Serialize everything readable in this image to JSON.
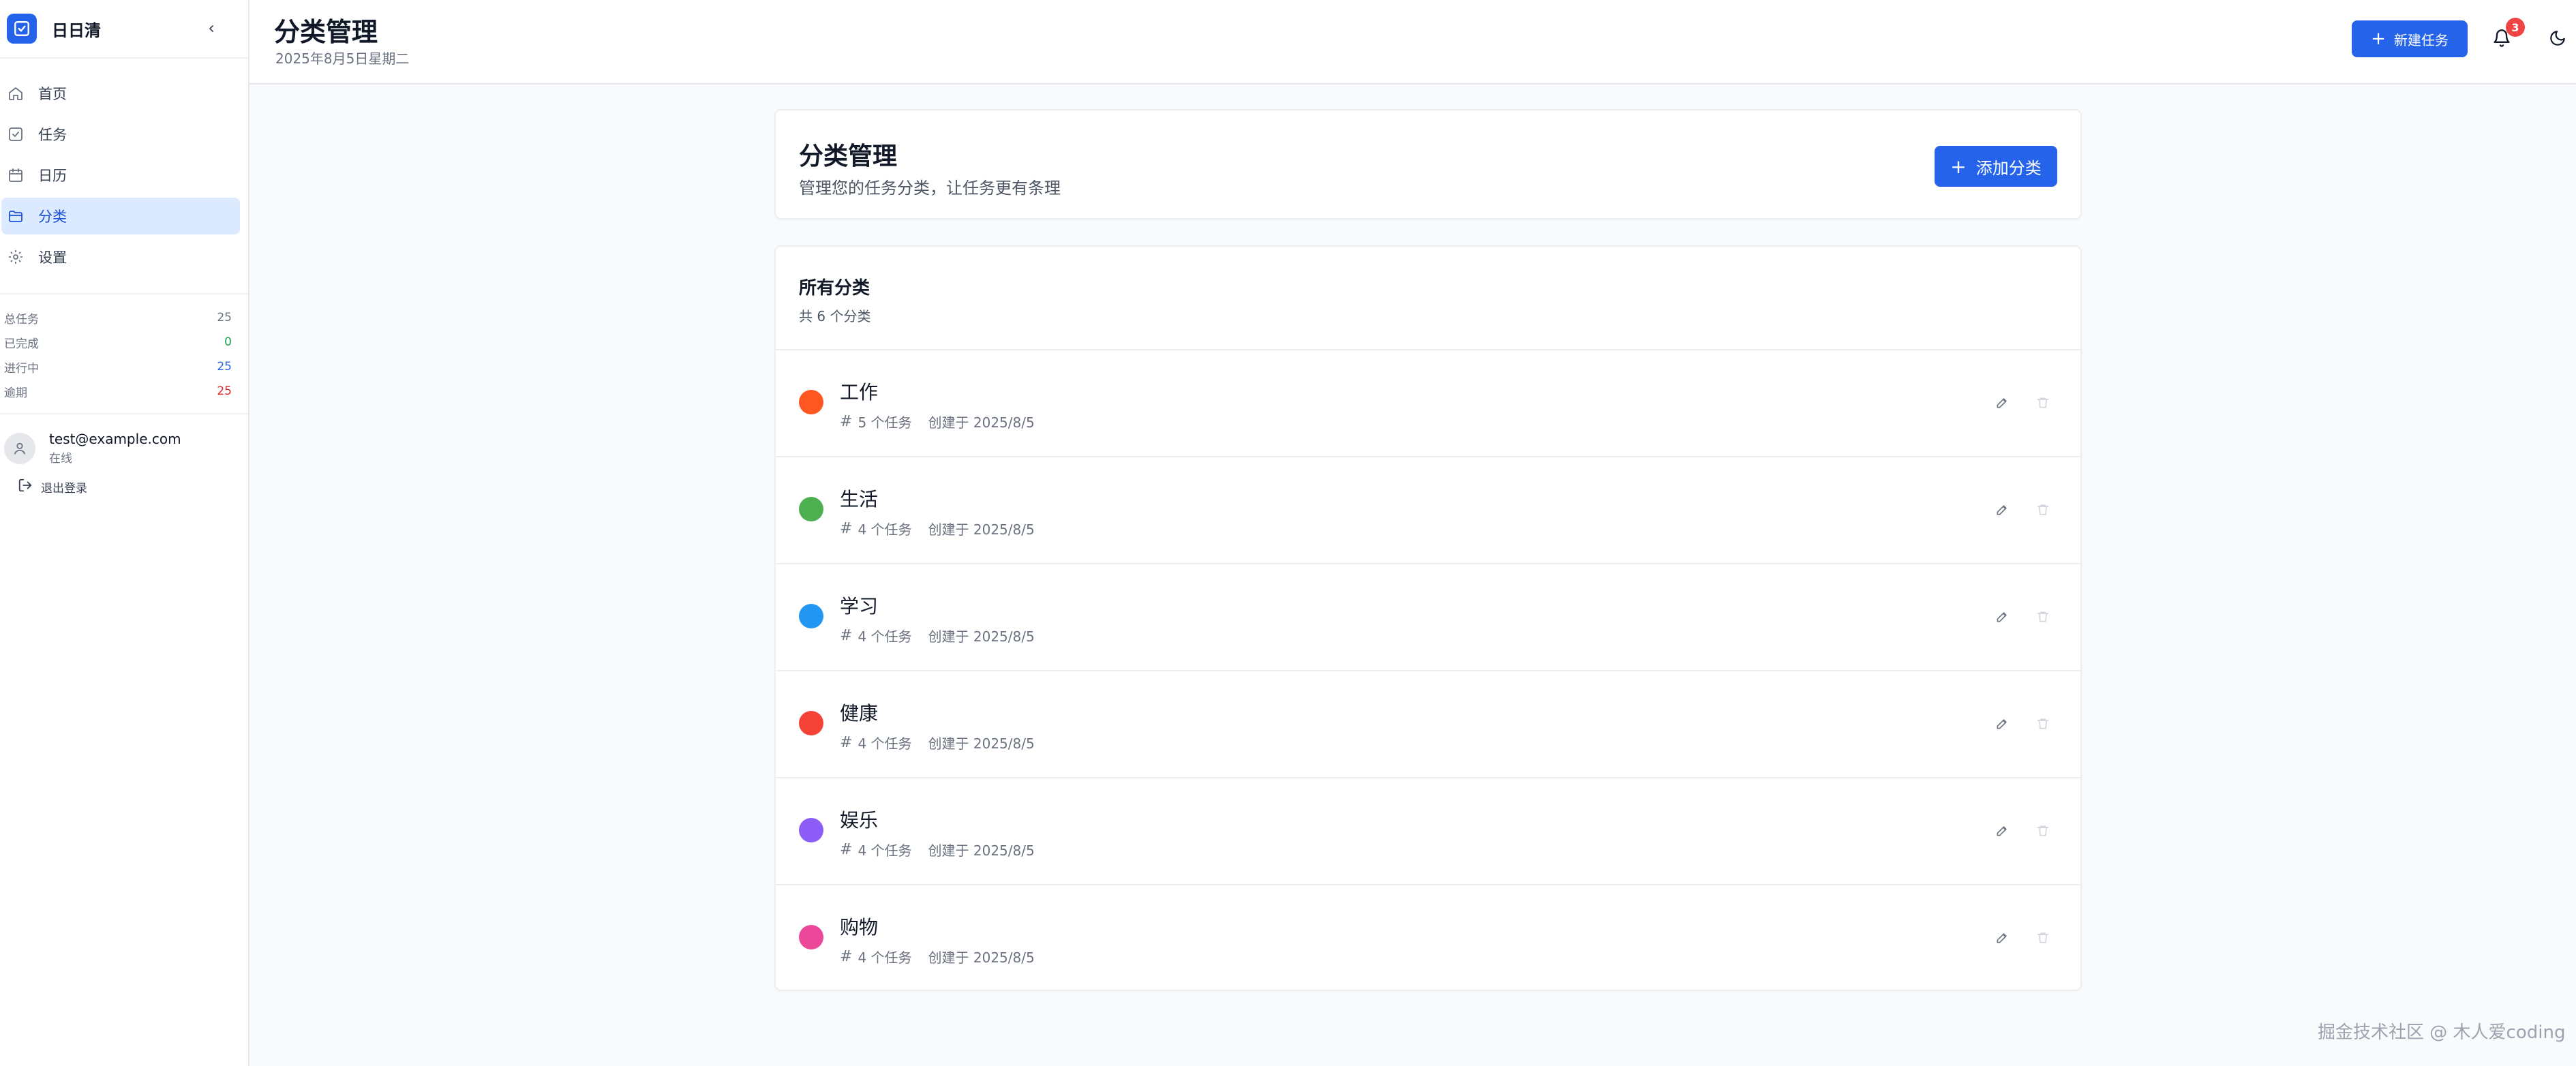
{
  "app": {
    "name": "日日清"
  },
  "sidebar": {
    "items": [
      {
        "label": "首页",
        "icon": "home-icon"
      },
      {
        "label": "任务",
        "icon": "task-check-icon"
      },
      {
        "label": "日历",
        "icon": "calendar-icon"
      },
      {
        "label": "分类",
        "icon": "folder-icon",
        "active": true
      },
      {
        "label": "设置",
        "icon": "gear-icon"
      }
    ],
    "stats": [
      {
        "label": "总任务",
        "value": "25",
        "color": "#6b7280"
      },
      {
        "label": "已完成",
        "value": "0",
        "color": "#16a34a"
      },
      {
        "label": "进行中",
        "value": "25",
        "color": "#2563eb"
      },
      {
        "label": "逾期",
        "value": "25",
        "color": "#dc2626"
      }
    ],
    "user": {
      "email": "test@example.com",
      "status": "在线"
    },
    "logout_label": "退出登录"
  },
  "header": {
    "title": "分类管理",
    "date": "2025年8月5日星期二",
    "new_task_label": "新建任务",
    "notification_count": "3"
  },
  "page": {
    "title": "分类管理",
    "subtitle": "管理您的任务分类，让任务更有条理",
    "add_label": "添加分类",
    "list_title": "所有分类",
    "list_count": "共 6 个分类"
  },
  "categories": [
    {
      "name": "工作",
      "tasks": "5 个任务",
      "created": "创建于 2025/8/5",
      "color": "#ff5722"
    },
    {
      "name": "生活",
      "tasks": "4 个任务",
      "created": "创建于 2025/8/5",
      "color": "#4caf50"
    },
    {
      "name": "学习",
      "tasks": "4 个任务",
      "created": "创建于 2025/8/5",
      "color": "#2196f3"
    },
    {
      "name": "健康",
      "tasks": "4 个任务",
      "created": "创建于 2025/8/5",
      "color": "#f44336"
    },
    {
      "name": "娱乐",
      "tasks": "4 个任务",
      "created": "创建于 2025/8/5",
      "color": "#8b5cf6"
    },
    {
      "name": "购物",
      "tasks": "4 个任务",
      "created": "创建于 2025/8/5",
      "color": "#ec4899"
    }
  ],
  "theme": {
    "accent": "#2563eb",
    "active_bg": "#dbeafe"
  },
  "watermark": "掘金技术社区 @ 木人爱coding"
}
